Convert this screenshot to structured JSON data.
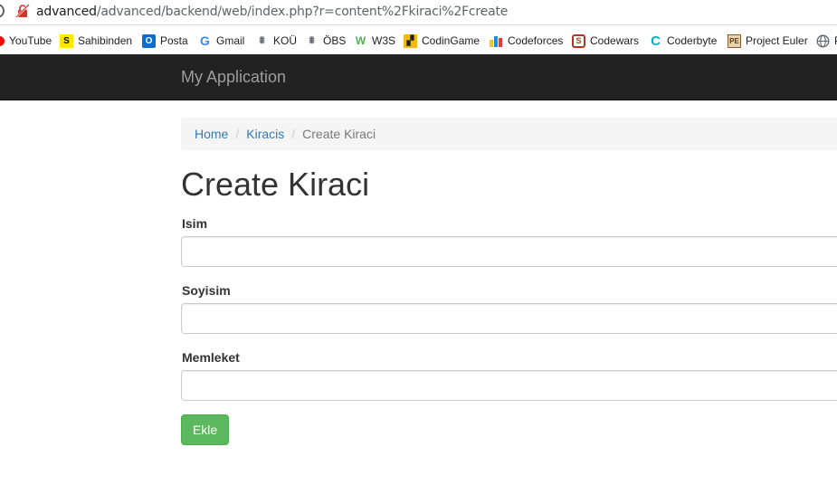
{
  "browser": {
    "url_host": "advanced",
    "url_path": "/advanced/backend/web/index.php?r=content%2Fkiraci%2Fcreate"
  },
  "bookmarks": [
    {
      "label": "YouTube",
      "icon": "youtube-icon",
      "color": "#ff0000"
    },
    {
      "label": "Sahibinden",
      "icon": "sahibinden-icon",
      "color": "#ffe800"
    },
    {
      "label": "Posta",
      "icon": "outlook-icon",
      "color": "#0a6ed1"
    },
    {
      "label": "Gmail",
      "icon": "google-icon",
      "color": "#4285f4"
    },
    {
      "label": "KOÜ",
      "icon": "kou-icon",
      "color": "#5f6368"
    },
    {
      "label": "ÖBS",
      "icon": "obs-icon",
      "color": "#5f6368"
    },
    {
      "label": "W3S",
      "icon": "w3schools-icon",
      "color": "#4caf50"
    },
    {
      "label": "CodinGame",
      "icon": "codingame-icon",
      "color": "#f2bb13"
    },
    {
      "label": "Codeforces",
      "icon": "codeforces-icon",
      "color": "#1e88e5"
    },
    {
      "label": "Codewars",
      "icon": "codewars-icon",
      "color": "#b1361e"
    },
    {
      "label": "Coderbyte",
      "icon": "coderbyte-icon",
      "color": "#00b2c6"
    },
    {
      "label": "Project Euler",
      "icon": "project-euler-icon",
      "color": "#8b5a2b"
    },
    {
      "label": "P",
      "icon": "globe-icon",
      "color": "#5f6368"
    }
  ],
  "navbar": {
    "brand": "My Application",
    "background": "#222222"
  },
  "breadcrumb": {
    "home": "Home",
    "section": "Kiracis",
    "current": "Create Kiraci"
  },
  "page": {
    "title": "Create Kiraci"
  },
  "form": {
    "fields": [
      {
        "label": "Isim",
        "value": ""
      },
      {
        "label": "Soyisim",
        "value": ""
      },
      {
        "label": "Memleket",
        "value": ""
      }
    ],
    "submit_label": "Ekle",
    "submit_color": "#5cb85c"
  }
}
